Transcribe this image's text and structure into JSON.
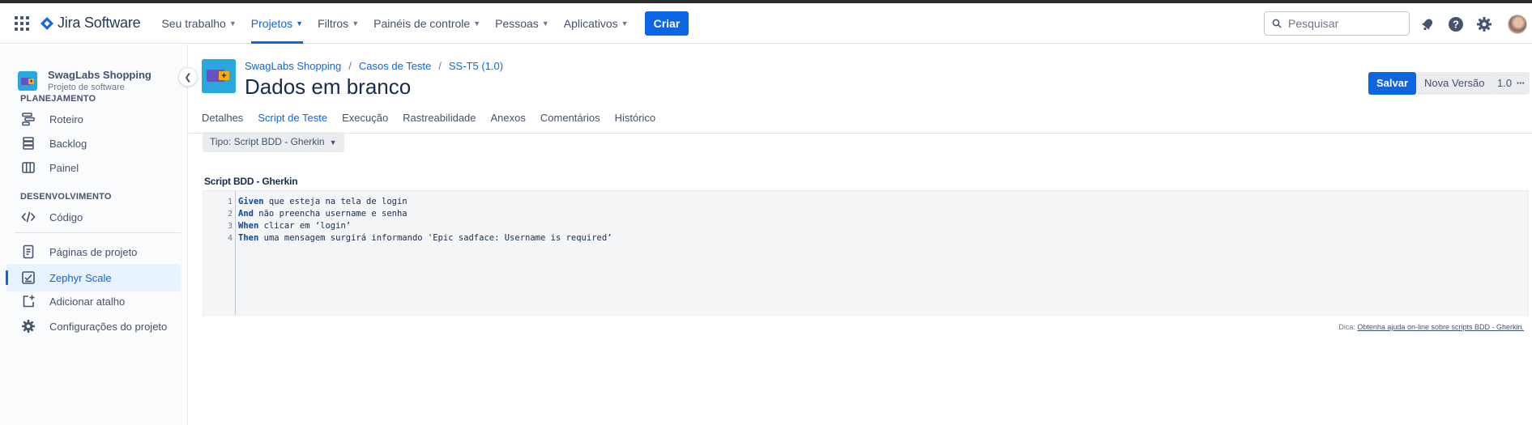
{
  "topnav": {
    "product": "Jira Software",
    "items": [
      {
        "label": "Seu trabalho",
        "active": false
      },
      {
        "label": "Projetos",
        "active": true
      },
      {
        "label": "Filtros",
        "active": false
      },
      {
        "label": "Painéis de controle",
        "active": false
      },
      {
        "label": "Pessoas",
        "active": false
      },
      {
        "label": "Aplicativos",
        "active": false
      }
    ],
    "create_label": "Criar",
    "search_placeholder": "Pesquisar",
    "icons": [
      "apps-icon",
      "bell-icon",
      "help-icon",
      "settings-icon",
      "avatar"
    ]
  },
  "sidebar": {
    "project_name": "SwagLabs Shopping",
    "project_type": "Projeto de software",
    "sections": [
      {
        "title": "PLANEJAMENTO",
        "items": [
          {
            "label": "Roteiro",
            "icon": "roadmap-icon"
          },
          {
            "label": "Backlog",
            "icon": "backlog-icon"
          },
          {
            "label": "Painel",
            "icon": "board-icon"
          }
        ]
      },
      {
        "title": "DESENVOLVIMENTO",
        "items": [
          {
            "label": "Código",
            "icon": "code-icon"
          }
        ]
      }
    ],
    "bottom_items": [
      {
        "label": "Páginas de projeto",
        "icon": "page-icon",
        "active": false
      },
      {
        "label": "Zephyr Scale",
        "icon": "zephyr-icon",
        "active": true
      },
      {
        "label": "Adicionar atalho",
        "icon": "add-shortcut-icon",
        "active": false
      },
      {
        "label": "Configurações do projeto",
        "icon": "gear-icon",
        "active": false
      }
    ]
  },
  "header": {
    "breadcrumbs": [
      "SwagLabs Shopping",
      "Casos de Teste",
      "SS-T5 (1.0)"
    ],
    "title": "Dados em branco",
    "save_label": "Salvar",
    "new_version_label": "Nova Versão",
    "version_label": "1.0",
    "more_label": "···"
  },
  "tabs": [
    {
      "label": "Detalhes",
      "active": false
    },
    {
      "label": "Script de Teste",
      "active": true
    },
    {
      "label": "Execução",
      "active": false
    },
    {
      "label": "Rastreabilidade",
      "active": false
    },
    {
      "label": "Anexos",
      "active": false
    },
    {
      "label": "Comentários",
      "active": false
    },
    {
      "label": "Histórico",
      "active": false
    }
  ],
  "content": {
    "type_dropdown": "Tipo: Script BDD - Gherkin",
    "script_title": "Script BDD - Gherkin",
    "lines": [
      {
        "num": "1",
        "keyword": "Given",
        "text": " que esteja na tela de login"
      },
      {
        "num": "2",
        "keyword": "And",
        "text": " não preencha username e senha"
      },
      {
        "num": "3",
        "keyword": "When",
        "text": " clicar em ‘login’"
      },
      {
        "num": "4",
        "keyword": "Then",
        "text": " uma mensagem surgirá informando 'Epic sadface: Username is required’"
      }
    ],
    "hint_prefix": "Dica:",
    "hint_link": "Obtenha ajuda on-line sobre scripts BDD - Gherkin."
  },
  "colors": {
    "accent": "#0c66e4",
    "keyword": "#0747a6"
  }
}
